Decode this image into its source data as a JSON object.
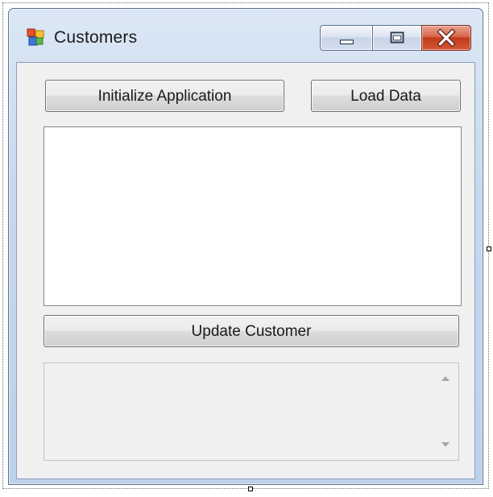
{
  "window": {
    "title": "Customers",
    "icon": "windows-form-icon"
  },
  "caption_buttons": {
    "minimize_icon": "minimize-icon",
    "maximize_icon": "maximize-icon",
    "close_icon": "close-icon"
  },
  "buttons": {
    "initialize": "Initialize Application",
    "load": "Load Data",
    "update": "Update Customer"
  },
  "listbox": {
    "items": []
  },
  "textarea": {
    "value": "",
    "scroll_up_icon": "scroll-up-arrow-icon",
    "scroll_down_icon": "scroll-down-arrow-icon"
  },
  "colors": {
    "frame": "#c6d8ee",
    "client_background": "#f0f0f0",
    "close_button": "#c2381a"
  }
}
